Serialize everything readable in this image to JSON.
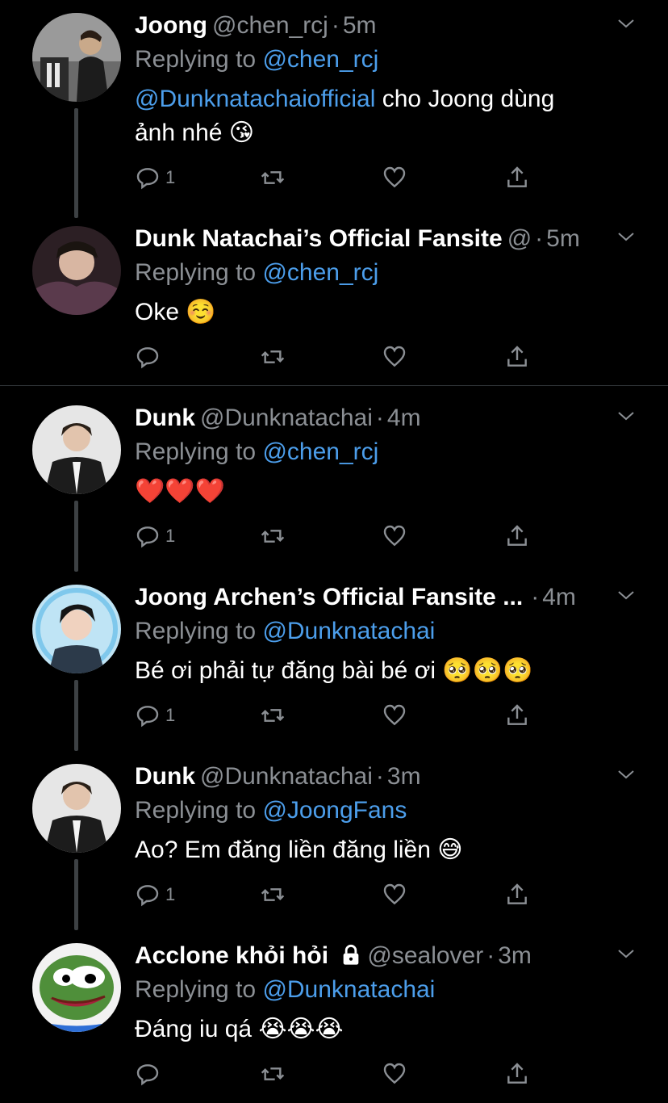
{
  "tweets": [
    {
      "name": "Joong",
      "handle": "@chen_rcj",
      "time": "5m",
      "replying_prefix": "Replying to ",
      "replying_to": "@chen_rcj",
      "mention": "@Dunknatachaiofficial",
      "text": " cho Joong dùng",
      "text2": "ảnh nhé 😘",
      "reply_count": "1",
      "avatar": "man-in-suit-photo"
    },
    {
      "name": "Dunk Natachai’s Official Fansite",
      "handle": "@",
      "time": "5m",
      "replying_prefix": "Replying to ",
      "replying_to": "@chen_rcj",
      "text": "Oke ☺️",
      "reply_count": "",
      "avatar": "young-man-photo"
    },
    {
      "name": "Dunk",
      "handle": "@Dunknatachai",
      "time": "4m",
      "replying_prefix": "Replying to ",
      "replying_to": "@chen_rcj",
      "text": "❤️❤️❤️",
      "reply_count": "1",
      "avatar": "man-in-black-suit-photo"
    },
    {
      "name": "Joong Archen’s Official Fansite ...",
      "handle": "",
      "time": "4m",
      "replying_prefix": "Replying to ",
      "replying_to": "@Dunknatachai",
      "text": "Bé ơi phải tự đăng bài bé ơi 🥺🥺🥺",
      "reply_count": "1",
      "avatar": "man-blue-background-photo"
    },
    {
      "name": "Dunk",
      "handle": "@Dunknatachai",
      "time": "3m",
      "replying_prefix": "Replying to ",
      "replying_to": "@JoongFans",
      "text": "Ao? Em đăng liền đăng liền 😅",
      "reply_count": "1",
      "avatar": "man-in-black-suit-photo"
    },
    {
      "name": "Acclone khỏi hỏi",
      "handle": "@sealover",
      "time": "3m",
      "replying_prefix": "Replying to ",
      "replying_to": "@Dunknatachai",
      "text": "Đáng iu qá 😭😭😭",
      "reply_count": "",
      "avatar": "pepe-frog-cartoon",
      "locked": "lock-icon"
    }
  ],
  "colors": {
    "background": "#000000",
    "muted": "#8b8f94",
    "link": "#4c9eeb",
    "thread_line": "#3d4144"
  }
}
